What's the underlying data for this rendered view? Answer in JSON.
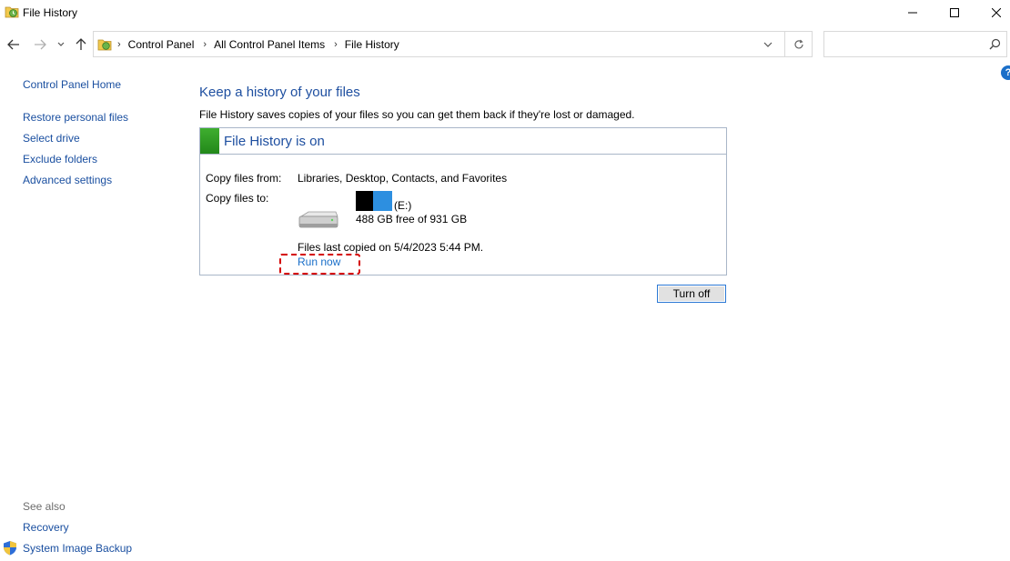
{
  "window": {
    "title": "File History",
    "icon": "file-history-icon"
  },
  "address": {
    "crumbs": [
      "Control Panel",
      "All Control Panel Items",
      "File History"
    ],
    "search_placeholder": ""
  },
  "sidebar": {
    "home": "Control Panel Home",
    "items": [
      {
        "label": "Restore personal files"
      },
      {
        "label": "Select drive"
      },
      {
        "label": "Exclude folders"
      },
      {
        "label": "Advanced settings"
      }
    ],
    "see_also_title": "See also",
    "see_also": [
      {
        "label": "Recovery"
      },
      {
        "label": "System Image Backup"
      }
    ]
  },
  "main": {
    "heading": "Keep a history of your files",
    "description": "File History saves copies of your files so you can get them back if they're lost or damaged.",
    "panel": {
      "status_title": "File History is on",
      "status_color": "#2e9c22",
      "copy_from_label": "Copy files from:",
      "copy_from_value": "Libraries, Desktop, Contacts, and Favorites",
      "copy_to_label": "Copy files to:",
      "drive_letter": "(E:)",
      "drive_space": "488 GB free of 931 GB",
      "last_copied": "Files last copied on 5/4/2023 5:44 PM.",
      "run_now": "Run now"
    },
    "turn_off": "Turn off"
  },
  "colors": {
    "link": "#1a4fa0",
    "heading": "#1e4fa0",
    "highlight": "#d40000",
    "button_border": "#2b78d4"
  }
}
